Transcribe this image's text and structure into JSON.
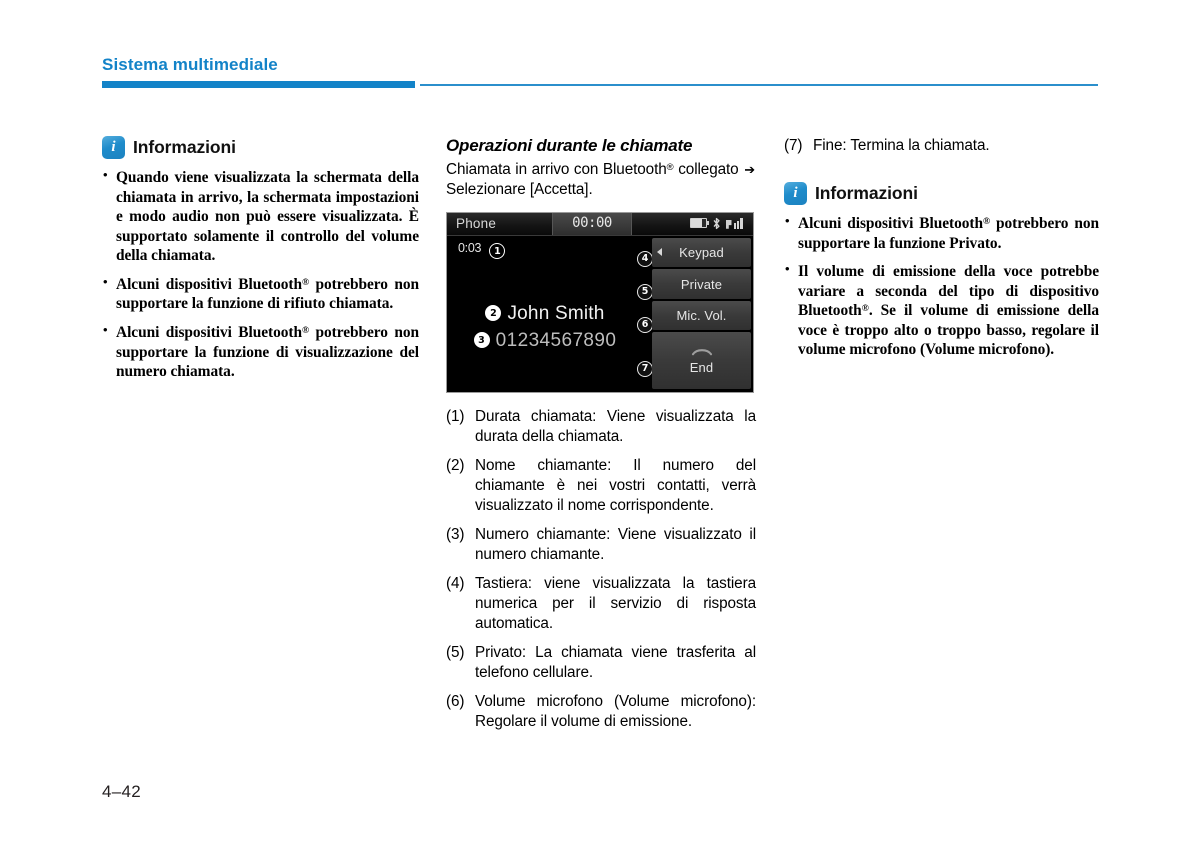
{
  "header": {
    "title": "Sistema multimediale",
    "accent_color": "#1383c8"
  },
  "footer": {
    "page_number": "4–42"
  },
  "column_1": {
    "info_box": {
      "icon_label": "i",
      "title": "Informazioni",
      "bullets": [
        "Quando viene visualizzata la schermata della chiamata in arrivo, la schermata impostazioni e modo audio non può essere visualizzata. È supportato solamente il controllo del volume della chiamata.",
        "Alcuni dispositivi Bluetooth® potrebbero non supportare la funzione di rifiuto chiamata.",
        "Alcuni dispositivi Bluetooth® potrebbero non supportare la funzione di visualizzazione del numero chiamata."
      ]
    }
  },
  "column_2": {
    "heading": "Operazioni durante le chiamate",
    "intro_before_arrow": "Chiamata in arrivo con Bluetooth® collegato",
    "intro_arrow": "➔",
    "intro_after_arrow": "Selezionare [Accetta].",
    "phone_screen": {
      "app_label": "Phone",
      "clock": "00:00",
      "call_duration": "0:03",
      "caller_name": "John Smith",
      "caller_number": "01234567890",
      "status_icons": [
        "battery-icon",
        "bluetooth-icon",
        "signal-icon"
      ],
      "callouts": {
        "duration": "1",
        "name": "2",
        "number": "3",
        "keypad": "4",
        "private": "5",
        "mic_vol": "6",
        "end": "7"
      },
      "buttons": [
        {
          "label": "Keypad",
          "has_prev_arrow": true
        },
        {
          "label": "Private",
          "has_prev_arrow": false
        },
        {
          "label": "Mic. Vol.",
          "has_prev_arrow": false
        },
        {
          "label": "End",
          "has_prev_arrow": false,
          "icon": "end-call-icon"
        }
      ]
    },
    "numbered_items": [
      {
        "marker": "(1)",
        "text": "Durata chiamata: Viene visualizzata la durata della chiamata."
      },
      {
        "marker": "(2)",
        "text": "Nome chiamante: Il numero del chiamante è nei vostri contatti, verrà visualizzato il nome corrispondente."
      },
      {
        "marker": "(3)",
        "text": "Numero chiamante: Viene visualizzato il numero chiamante."
      },
      {
        "marker": "(4)",
        "text": "Tastiera: viene visualizzata la tastiera numerica per il servizio di risposta automatica."
      },
      {
        "marker": "(5)",
        "text": "Privato: La chiamata viene trasferita al telefono cellulare."
      },
      {
        "marker": "(6)",
        "text": "Volume microfono (Volume microfono): Regolare il volume di emissione."
      }
    ]
  },
  "column_3": {
    "numbered_items": [
      {
        "marker": "(7)",
        "text": "Fine: Termina la chiamata."
      }
    ],
    "info_box": {
      "icon_label": "i",
      "title": "Informazioni",
      "bullets": [
        "Alcuni dispositivi Bluetooth® potrebbero non supportare la funzione Privato.",
        "Il volume di emissione della voce potrebbe variare a seconda del tipo di dispositivo Bluetooth®. Se il volume di emissione della voce è troppo alto o troppo basso, regolare il volume microfono (Volume microfono)."
      ]
    }
  }
}
